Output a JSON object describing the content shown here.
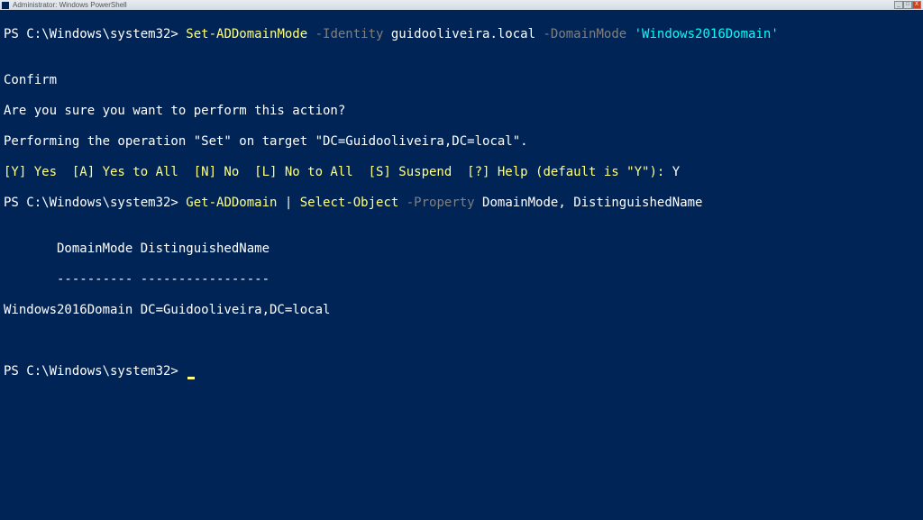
{
  "window": {
    "title": "Administrator: Windows PowerShell"
  },
  "controls": {
    "minimize": "_",
    "maximize": "□",
    "close": "X"
  },
  "line1": {
    "prompt": "PS C:\\Windows\\system32> ",
    "cmd": "Set-ADDomainMode",
    "p1name": " -Identity ",
    "p1val": "guidooliveira.local",
    "p2name": " -DomainMode ",
    "p2val": "'Windows2016Domain'"
  },
  "confirm": {
    "blank1": "",
    "l1": "Confirm",
    "l2": "Are you sure you want to perform this action?",
    "l3": "Performing the operation \"Set\" on target \"DC=Guidooliveira,DC=local\".",
    "opts": "[Y] Yes  [A] Yes to All  [N] No  [L] No to All  [S] Suspend  [?] Help (default is \"Y\"):",
    "answer": " Y"
  },
  "line2": {
    "prompt": "PS C:\\Windows\\system32> ",
    "cmd": "Get-ADDomain",
    "pipe": " | ",
    "cmd2": "Select-Object",
    "p1name": " -Property ",
    "p1val": "DomainMode, DistinguishedName"
  },
  "table": {
    "blank": "",
    "header": "       DomainMode DistinguishedName",
    "divider": "       ---------- -----------------",
    "row1": "Windows2016Domain DC=Guidooliveira,DC=local"
  },
  "line3": {
    "blank1": "",
    "blank2": "",
    "prompt": "PS C:\\Windows\\system32> "
  }
}
